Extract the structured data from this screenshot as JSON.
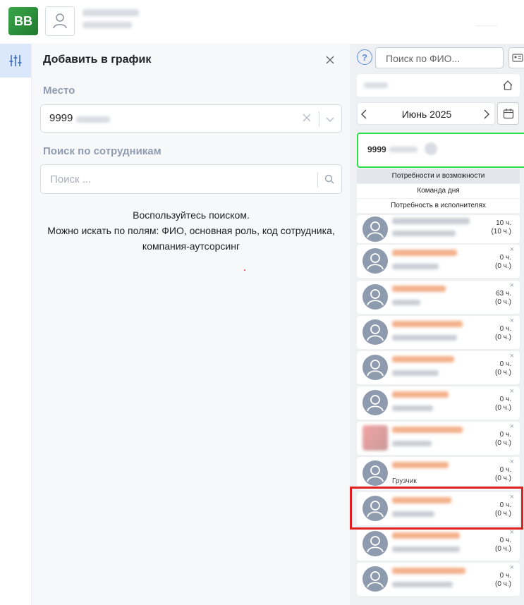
{
  "header": {
    "logo_text": "BB"
  },
  "rail": {
    "filter_icon": "sliders-icon"
  },
  "panel": {
    "title": "Добавить в график",
    "place_label": "Место",
    "place_value": "9999",
    "employee_search_label": "Поиск по сотрудникам",
    "employee_search_placeholder": "Поиск ...",
    "help_lines": [
      "Воспользуйтесь поиском.",
      "Можно искать по полям: ФИО, основная роль, код сотрудника,",
      "компания-аутсорсинг"
    ]
  },
  "right": {
    "help_icon_text": "?",
    "fio_search_placeholder": "Поиск по ФИО...",
    "month": "Июнь 2025",
    "store_code": "9999",
    "sections": [
      "Потребности и возможности",
      "Команда дня",
      "Потребность в исполнителях"
    ],
    "employees": [
      {
        "role": "",
        "hours": "10 ч.",
        "hours_total": "(10 ч.)",
        "photo": false
      },
      {
        "role": "",
        "hours": "0 ч.",
        "hours_total": "(0 ч.)",
        "photo": false
      },
      {
        "role": "",
        "hours": "63 ч.",
        "hours_total": "(0 ч.)",
        "photo": false
      },
      {
        "role": "",
        "hours": "0 ч.",
        "hours_total": "(0 ч.)",
        "photo": false
      },
      {
        "role": "",
        "hours": "0 ч.",
        "hours_total": "(0 ч.)",
        "photo": false
      },
      {
        "role": "",
        "hours": "0 ч.",
        "hours_total": "(0 ч.)",
        "photo": false
      },
      {
        "role": "",
        "hours": "0 ч.",
        "hours_total": "(0 ч.)",
        "photo": true
      },
      {
        "role": "Грузчик",
        "hours": "0 ч.",
        "hours_total": "(0 ч.)",
        "photo": false
      },
      {
        "role": "",
        "hours": "0 ч.",
        "hours_total": "(0 ч.)",
        "photo": false
      },
      {
        "role": "",
        "hours": "0 ч.",
        "hours_total": "(0 ч.)",
        "photo": false
      },
      {
        "role": "",
        "hours": "0 ч.",
        "hours_total": "(0 ч.)",
        "photo": false
      }
    ],
    "remove_symbol": "×"
  },
  "colors": {
    "highlight_green": "#2ee04a",
    "highlight_red": "#e0201f",
    "rail_active": "#dbe7fb",
    "accent_blue": "#5b8fd9"
  }
}
